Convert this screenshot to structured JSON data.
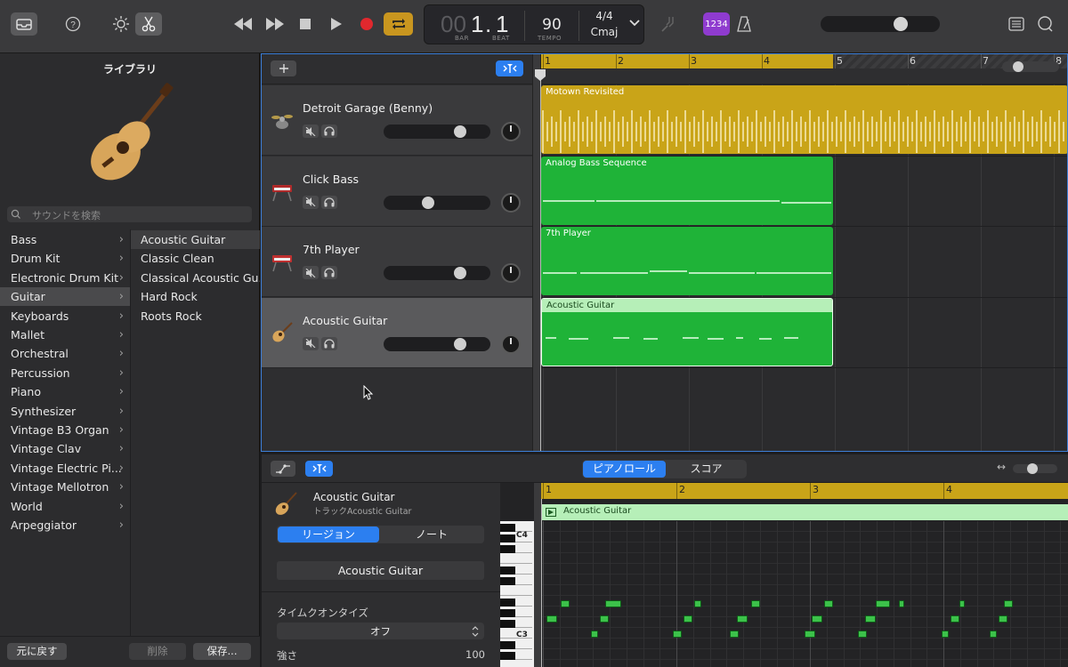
{
  "toolbar": {
    "lcd": {
      "bar_dim": "00",
      "bar": "1",
      "beat_dot": ".",
      "beat": "1",
      "bar_label": "BAR",
      "beat_label": "BEAT",
      "tempo": "90",
      "tempo_label": "TEMPO",
      "signature": "4/4",
      "key": "Cmaj"
    },
    "count_in": "1234"
  },
  "library": {
    "title": "ライブラリ",
    "search_placeholder": "サウンドを検索",
    "categories": [
      "Bass",
      "Drum Kit",
      "Electronic Drum Kit",
      "Guitar",
      "Keyboards",
      "Mallet",
      "Orchestral",
      "Percussion",
      "Piano",
      "Synthesizer",
      "Vintage B3 Organ",
      "Vintage Clav",
      "Vintage Electric Pi...",
      "Vintage Mellotron",
      "World",
      "Arpeggiator"
    ],
    "selected_category": "Guitar",
    "sounds": [
      "Acoustic Guitar",
      "Classic Clean",
      "Classical Acoustic Gu...",
      "Hard Rock",
      "Roots Rock"
    ],
    "selected_sound": "Acoustic Guitar",
    "revert": "元に戻す",
    "delete": "削除",
    "save": "保存..."
  },
  "tracks": [
    {
      "name": "Detroit Garage (Benny)",
      "volume": 0.72
    },
    {
      "name": "Click Bass",
      "volume": 0.42
    },
    {
      "name": "7th Player",
      "volume": 0.72
    },
    {
      "name": "Acoustic Guitar",
      "volume": 0.72
    }
  ],
  "ruler": [
    "1",
    "2",
    "3",
    "4",
    "5",
    "6",
    "7",
    "8"
  ],
  "regions": [
    {
      "name": "Motown Revisited"
    },
    {
      "name": "Analog Bass Sequence"
    },
    {
      "name": "7th Player"
    },
    {
      "name": "Acoustic Guitar"
    }
  ],
  "editor": {
    "tab_piano": "ピアノロール",
    "tab_score": "スコア",
    "track_name": "Acoustic Guitar",
    "track_sub": "トラックAcoustic Guitar",
    "seg_region": "リージョン",
    "seg_note": "ノート",
    "region_name": "Acoustic Guitar",
    "quantize_label": "タイムクオンタイズ",
    "quantize_value": "オフ",
    "strength_label": "強さ",
    "strength_value": "100",
    "ruler": [
      "1",
      "2",
      "3",
      "4"
    ],
    "region_label": "Acoustic Guitar",
    "key_c4": "C4",
    "key_c3": "C3"
  },
  "colors": {
    "accent": "#2c7ff0",
    "drummer": "#c9a418",
    "midi": "#1fb338",
    "record": "#e0282e",
    "cycle": "#c9961f"
  }
}
